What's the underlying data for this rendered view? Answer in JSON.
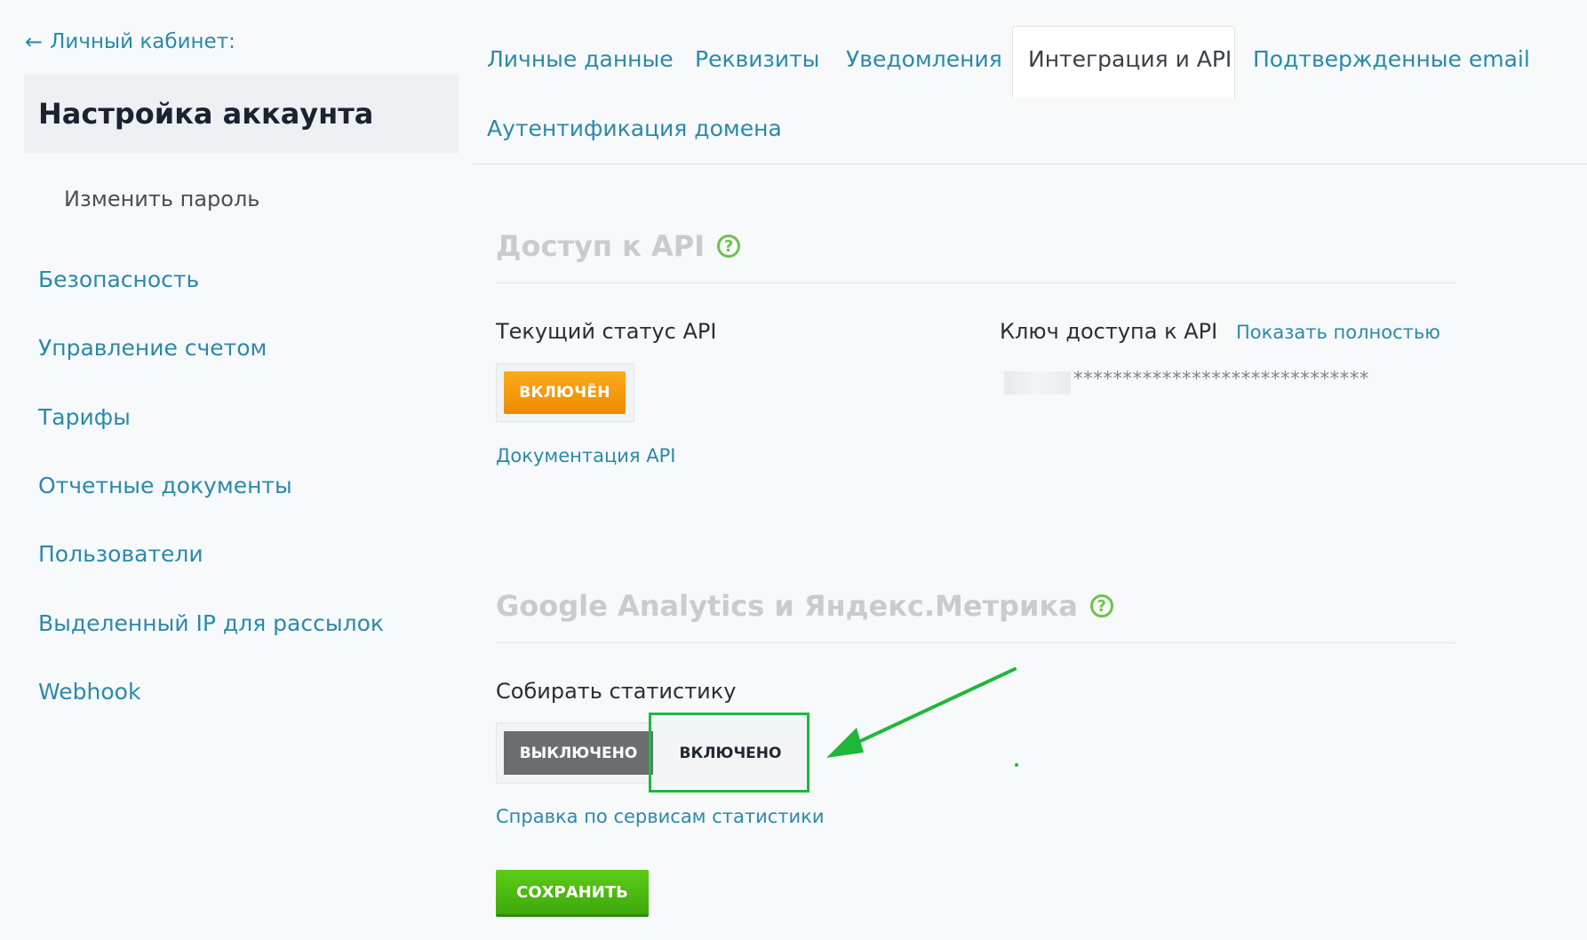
{
  "sidebar": {
    "back_arrow": "←",
    "back_label": "Личный кабинет:",
    "active_title": "Настройка аккаунта",
    "sub_item": "Изменить пароль",
    "items": [
      {
        "label": "Безопасность"
      },
      {
        "label": "Управление счетом"
      },
      {
        "label": "Тарифы"
      },
      {
        "label": "Отчетные документы"
      },
      {
        "label": "Пользователи"
      },
      {
        "label": "Выделенный IP для рассылок"
      },
      {
        "label": "Webhook"
      }
    ]
  },
  "tabs": [
    {
      "label": "Личные данные"
    },
    {
      "label": "Реквизиты"
    },
    {
      "label": "Уведомления"
    },
    {
      "label": "Интеграция и API",
      "active": true
    },
    {
      "label": "Подтвержденные email"
    },
    {
      "label": "Аутентификация домена"
    }
  ],
  "api": {
    "title": "Доступ к API",
    "help": "?",
    "status_label": "Текущий статус API",
    "status_button": "ВКЛЮЧЁН",
    "docs_link": "Документация API",
    "key_label": "Ключ доступа к API",
    "show_full_link": "Показать полностью",
    "key_masked": "******************************"
  },
  "analytics": {
    "title": "Google Analytics и Яндекс.Метрика",
    "help": "?",
    "collect_label": "Собирать статистику",
    "off_button": "ВЫКЛЮЧЕНО",
    "on_button": "ВКЛЮЧЕНО",
    "help_link": "Справка по сервисам статистики"
  },
  "save_button": "СОХРАНИТЬ",
  "colors": {
    "link": "#2a8aa9",
    "orange": "#f39200",
    "green": "#4cbb12",
    "highlight": "#1fb83a"
  }
}
